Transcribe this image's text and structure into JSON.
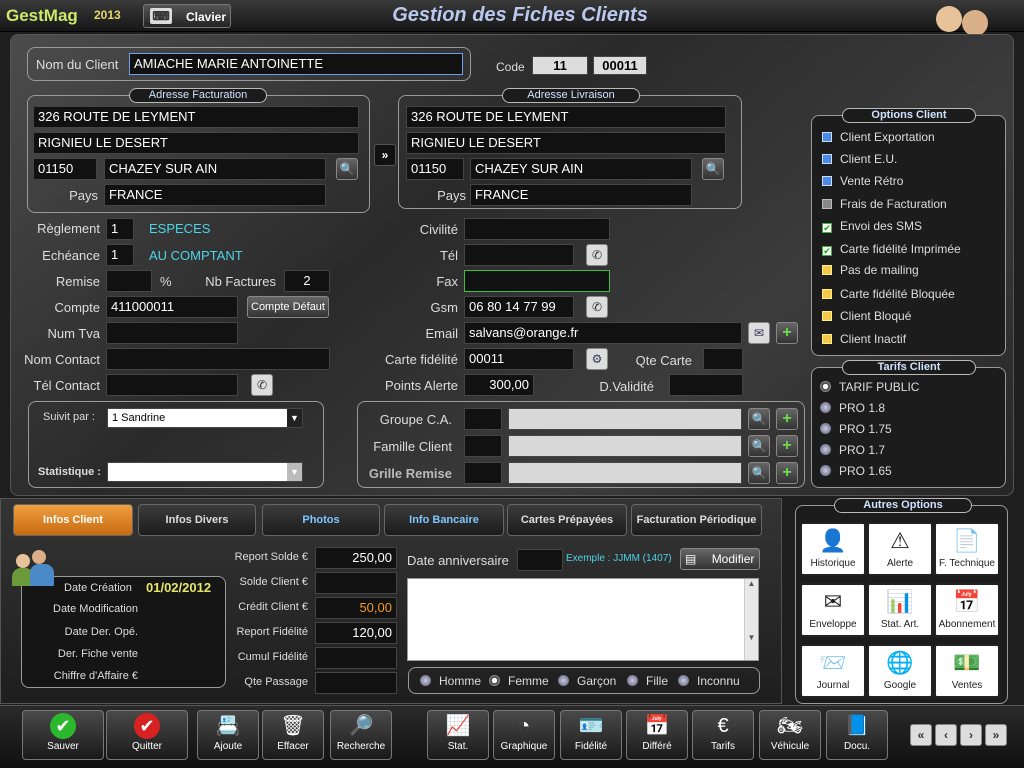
{
  "app": {
    "logo": "GestMag",
    "year": "2013",
    "keyboard_label": "Clavier",
    "title": "Gestion des Fiches Clients"
  },
  "client": {
    "name_label": "Nom du Client",
    "name_value": "AMIACHE MARIE ANTOINETTE",
    "code_label": "Code",
    "code1": "11",
    "code2": "00011"
  },
  "billing": {
    "legend": "Adresse Facturation",
    "line1": "326 ROUTE DE LEYMENT",
    "line2": "RIGNIEU LE DESERT",
    "zip": "01150",
    "city": "CHAZEY SUR AIN",
    "country_label": "Pays",
    "country": "FRANCE"
  },
  "delivery": {
    "legend": "Adresse Livraison",
    "line1": "326 ROUTE DE LEYMENT",
    "line2": "RIGNIEU LE DESERT",
    "zip": "01150",
    "city": "CHAZEY SUR AIN",
    "country_label": "Pays",
    "country": "FRANCE"
  },
  "left_form": {
    "reglement_label": "Règlement",
    "reglement_code": "1",
    "reglement_text": "ESPECES",
    "echeance_label": "Echéance",
    "echeance_code": "1",
    "echeance_text": "AU COMPTANT",
    "remise_label": "Remise",
    "remise_value": "",
    "percent": "%",
    "nb_factures_label": "Nb Factures",
    "nb_factures_value": "2",
    "compte_label": "Compte",
    "compte_value": "411000011",
    "compte_defaut": "Compte Défaut",
    "num_tva_label": "Num Tva",
    "num_tva_value": "",
    "nom_contact_label": "Nom Contact",
    "nom_contact_value": "",
    "tel_contact_label": "Tél Contact",
    "tel_contact_value": "",
    "suivi_label": "Suivit par :",
    "suivi_value": "1 Sandrine",
    "statistique_label": "Statistique :",
    "statistique_value": ""
  },
  "right_form": {
    "civilite_label": "Civilité",
    "civilite_value": "",
    "tel_label": "Tél",
    "tel_value": "",
    "fax_label": "Fax",
    "fax_value": "",
    "gsm_label": "Gsm",
    "gsm_value": "06 80 14 77 99",
    "email_label": "Email",
    "email_value": "salvans@orange.fr",
    "carte_label": "Carte fidélité",
    "carte_value": "00011",
    "qte_carte_label": "Qte Carte",
    "qte_carte_value": "",
    "points_label": "Points Alerte",
    "points_value": "300,00",
    "validite_label": "D.Validité",
    "validite_value": "",
    "groupe_label": "Groupe C.A.",
    "famille_label": "Famille Client",
    "grille_label": "Grille Remise"
  },
  "options_client": {
    "legend": "Options Client",
    "items": [
      {
        "label": "Client Exportation",
        "state": "blue"
      },
      {
        "label": "Client E.U.",
        "state": "blue"
      },
      {
        "label": "Vente Rétro",
        "state": "blue"
      },
      {
        "label": "Frais de Facturation",
        "state": "gray"
      },
      {
        "label": "Envoi des SMS",
        "state": "checked"
      },
      {
        "label": "Carte fidélité Imprimée",
        "state": "checked"
      },
      {
        "label": "Pas de mailing",
        "state": "yellow"
      },
      {
        "label": "Carte fidélité Bloquée",
        "state": "yellow"
      },
      {
        "label": "Client Bloqué",
        "state": "yellow"
      },
      {
        "label": "Client Inactif",
        "state": "yellow"
      }
    ]
  },
  "tarifs": {
    "legend": "Tarifs Client",
    "items": [
      "TARIF PUBLIC",
      "PRO 1.8",
      "PRO 1.75",
      "PRO 1.7",
      "PRO 1.65"
    ],
    "selected": "TARIF PUBLIC"
  },
  "autres": {
    "legend": "Autres Options",
    "items": [
      {
        "label": "Historique",
        "icon": "person-icon"
      },
      {
        "label": "Alerte",
        "icon": "warning-icon"
      },
      {
        "label": "F. Technique",
        "icon": "document-icon"
      },
      {
        "label": "Enveloppe",
        "icon": "envelope-icon"
      },
      {
        "label": "Stat. Art.",
        "icon": "chart-person-icon"
      },
      {
        "label": "Abonnement",
        "icon": "calendar-icon"
      },
      {
        "label": "Journal",
        "icon": "mail-icon"
      },
      {
        "label": "Google",
        "icon": "globe-icon"
      },
      {
        "label": "Ventes",
        "icon": "money-icon"
      }
    ]
  },
  "tabs": [
    {
      "label": "Infos Client",
      "active": true
    },
    {
      "label": "Infos Divers"
    },
    {
      "label": "Photos",
      "color": "blue"
    },
    {
      "label": "Info Bancaire",
      "color": "blue"
    },
    {
      "label": "Cartes Prépayées"
    },
    {
      "label": "Facturation Périodique"
    }
  ],
  "infos": {
    "date_creation_label": "Date Création",
    "date_creation": "01/02/2012",
    "date_modif_label": "Date Modification",
    "date_der_ope_label": "Date Der. Opé.",
    "der_fiche_label": "Der. Fiche vente",
    "ca_label": "Chiffre d'Affaire €",
    "report_solde_label": "Report Solde €",
    "report_solde": "250,00",
    "solde_client_label": "Solde Client €",
    "solde_client": "",
    "credit_client_label": "Crédit Client €",
    "credit_client": "50,00",
    "report_fid_label": "Report Fidélité",
    "report_fid": "120,00",
    "cumul_fid_label": "Cumul Fidélité",
    "cumul_fid": "",
    "qte_passage_label": "Qte Passage",
    "qte_passage": "",
    "anniv_label": "Date anniversaire",
    "anniv_example": "Exemple : JJMM (1407)",
    "modifier": "Modifier",
    "genders": [
      "Homme",
      "Femme",
      "Garçon",
      "Fille",
      "Inconnu"
    ],
    "gender_selected": "Femme"
  },
  "toolbar": [
    {
      "label": "Sauver",
      "icon": "check-icon"
    },
    {
      "label": "Quitter",
      "icon": "check-icon"
    },
    {
      "label": "Ajoute",
      "icon": "contact-card-icon"
    },
    {
      "label": "Effacer",
      "icon": "trash-icon"
    },
    {
      "label": "Recherche",
      "icon": "search-doc-icon"
    },
    {
      "label": "Stat.",
      "icon": "chart-icon"
    },
    {
      "label": "Graphique",
      "icon": "pie-icon"
    },
    {
      "label": "Fidélité",
      "icon": "card-icon"
    },
    {
      "label": "Différé",
      "icon": "calendar-icon"
    },
    {
      "label": "Tarifs",
      "icon": "euro-person-icon"
    },
    {
      "label": "Véhicule",
      "icon": "vehicle-icon"
    },
    {
      "label": "Docu.",
      "icon": "book-icon"
    }
  ]
}
